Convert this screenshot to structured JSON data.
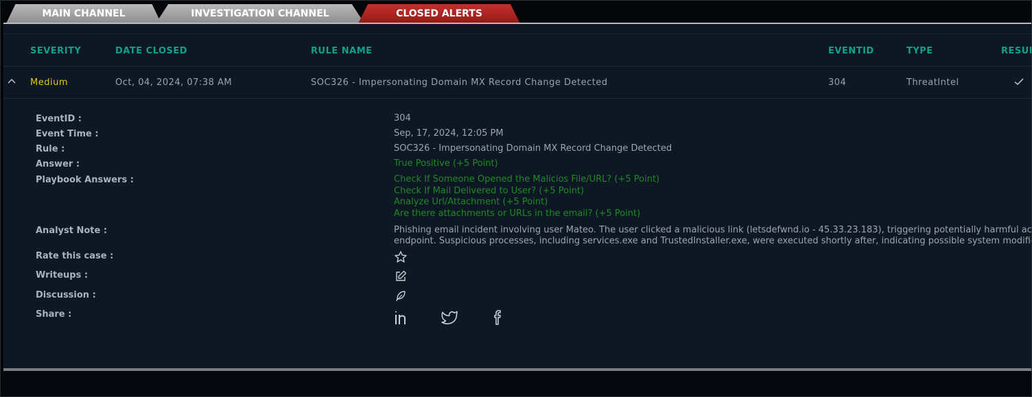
{
  "tabs": [
    {
      "label": "MAIN CHANNEL"
    },
    {
      "label": "INVESTIGATION CHANNEL"
    },
    {
      "label": "CLOSED ALERTS"
    }
  ],
  "table": {
    "headers": [
      "SEVERITY",
      "DATE CLOSED",
      "RULE NAME",
      "EVENTID",
      "TYPE",
      "RESULT"
    ],
    "row": {
      "severity": "Medium",
      "date_closed": "Oct, 04, 2024, 07:38 AM",
      "rule_name": "SOC326 - Impersonating Domain MX Record Change Detected",
      "event_id": "304",
      "type": "ThreatIntel"
    }
  },
  "details": {
    "labels": {
      "event_id": "EventID :",
      "event_time": "Event Time :",
      "rule": "Rule :",
      "answer": "Answer :",
      "playbook": "Playbook Answers :",
      "analyst_note": "Analyst Note :",
      "rate": "Rate this case :",
      "writeups": "Writeups :",
      "discussion": "Discussion :",
      "share": "Share :"
    },
    "values": {
      "event_id": "304",
      "event_time": "Sep, 17, 2024, 12:05 PM",
      "rule": "SOC326 - Impersonating Domain MX Record Change Detected",
      "answer": "True Positive (+5 Point)",
      "playbook": [
        "Check If Someone Opened the Malicios File/URL? (+5 Point)",
        "Check If Mail Delivered to User? (+5 Point)",
        "Analyze Url/Attachment (+5 Point)",
        "Are there attachments or URLs in the email? (+5 Point)"
      ],
      "analyst_note": [
        "Phishing email incident involving user Mateo. The user clicked a malicious link (letsdefwnd.io - 45.33.23.183), triggering potentially harmful actions on the",
        "endpoint. Suspicious processes, including services.exe and TrustedInstaller.exe, were executed shortly after, indicating possible system modifications."
      ]
    }
  },
  "icons": {
    "expand": "chevron-up-icon",
    "result": "check-icon",
    "rate": "star-icon",
    "writeups": "edit-icon",
    "discussion": "feather-icon",
    "share": [
      "linkedin-icon",
      "twitter-icon",
      "facebook-icon"
    ]
  },
  "colors": {
    "header_text": "#13a089",
    "severity_medium": "#e0c91a",
    "answer_green": "#1f8a24",
    "active_tab": "#b52420",
    "panel_bg": "#0e1724"
  }
}
